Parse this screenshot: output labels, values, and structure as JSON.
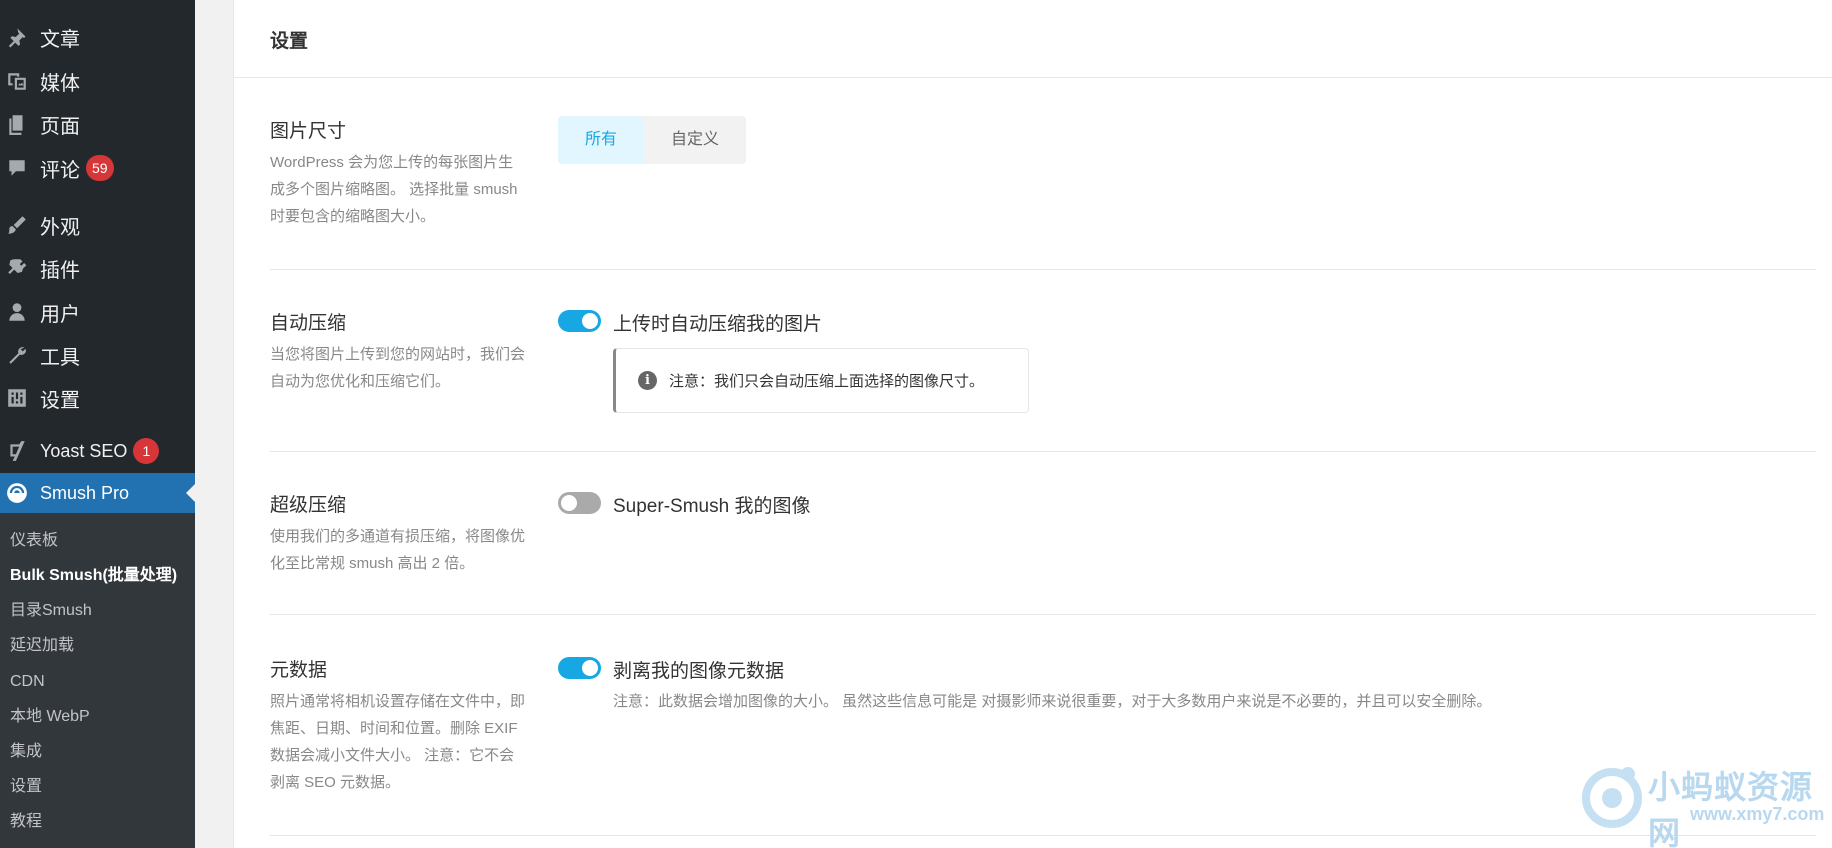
{
  "sidebar": {
    "items": [
      {
        "label": "文章",
        "icon": "pin-icon"
      },
      {
        "label": "媒体",
        "icon": "media-icon"
      },
      {
        "label": "页面",
        "icon": "pages-icon"
      },
      {
        "label": "评论",
        "icon": "comments-icon",
        "badge": "59"
      },
      {
        "label": "外观",
        "icon": "appearance-icon"
      },
      {
        "label": "插件",
        "icon": "plugins-icon"
      },
      {
        "label": "用户",
        "icon": "users-icon"
      },
      {
        "label": "工具",
        "icon": "tools-icon"
      },
      {
        "label": "设置",
        "icon": "settings-icon"
      },
      {
        "label": "Yoast SEO",
        "icon": "yoast-icon",
        "badge": "1"
      },
      {
        "label": "Smush Pro",
        "icon": "smush-icon",
        "active": true
      }
    ],
    "submenu": [
      {
        "label": "仪表板"
      },
      {
        "label": "Bulk Smush(批量处理)",
        "current": true
      },
      {
        "label": "目录Smush"
      },
      {
        "label": "延迟加载"
      },
      {
        "label": "CDN"
      },
      {
        "label": "本地 WebP"
      },
      {
        "label": "集成"
      },
      {
        "label": "设置"
      },
      {
        "label": "教程"
      }
    ]
  },
  "card": {
    "title": "设置",
    "image_sizes": {
      "title": "图片尺寸",
      "desc": "WordPress 会为您上传的每张图片生成多个图片缩略图。 选择批量 smush时要包含的缩略图大小。",
      "options": [
        "所有",
        "自定义"
      ],
      "selected": "所有"
    },
    "auto_compress": {
      "title": "自动压缩",
      "desc": "当您将图片上传到您的网站时，我们会自动为您优化和压缩它们。",
      "toggle_label": "上传时自动压缩我的图片",
      "enabled": true,
      "notice": "注意：我们只会自动压缩上面选择的图像尺寸。"
    },
    "super_smush": {
      "title": "超级压缩",
      "desc": "使用我们的多通道有损压缩，将图像优化至比常规 smush 高出 2 倍。",
      "toggle_label": "Super-Smush 我的图像",
      "enabled": false
    },
    "metadata": {
      "title": "元数据",
      "desc": "照片通常将相机设置存储在文件中，即焦距、日期、时间和位置。删除 EXIF 数据会减小文件大小。 注意：它不会剥离 SEO 元数据。",
      "toggle_label": "剥离我的图像元数据",
      "enabled": true,
      "note": "注意：此数据会增加图像的大小。 虽然这些信息可能是 对摄影师来说很重要，对于大多数用户来说是不必要的，并且可以安全删除。"
    }
  },
  "watermark": {
    "title": "小蚂蚁资源网",
    "url": "www.xmy7.com"
  },
  "colors": {
    "sidebar_bg": "#23282d",
    "submenu_bg": "#32373c",
    "active_bg": "#2271b1",
    "badge": "#d63638",
    "toggle_on": "#17a8e3",
    "toggle_off": "#aaaaaa"
  }
}
